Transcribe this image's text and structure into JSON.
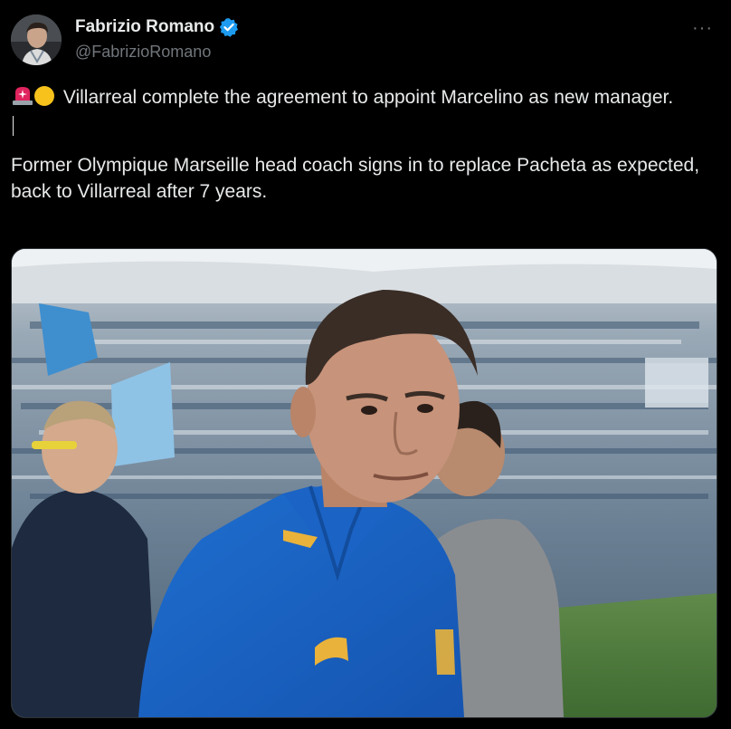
{
  "author": {
    "name": "Fabrizio Romano",
    "handle": "@FabrizioRomano",
    "verified": true,
    "avatar_icon": "avatar-image",
    "verified_icon": "verified-badge-icon"
  },
  "menu": {
    "more_label": "···"
  },
  "tweet": {
    "line1": "Villarreal complete the agreement to appoint Marcelino as new manager.",
    "line2": "Former Olympique Marseille head coach signs in to replace Pacheta as expected, back to Villarreal after 7 years.",
    "emoji": [
      "siren-icon",
      "yellow-circle-icon"
    ]
  },
  "media": {
    "kind": "photo",
    "subject": "man in blue polo shirt in stadium"
  },
  "colors": {
    "background": "#000000",
    "text": "#e7e9ea",
    "secondary": "#71767b",
    "verified": "#1d9bf0"
  }
}
